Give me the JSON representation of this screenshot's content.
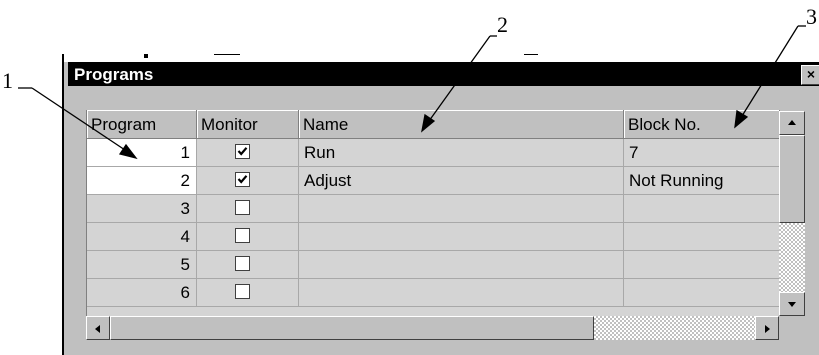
{
  "callouts": [
    "1",
    "2",
    "3"
  ],
  "window": {
    "title": "Programs",
    "close_glyph": "×"
  },
  "columns": [
    "Program",
    "Monitor",
    "Name",
    "Block No."
  ],
  "rows": [
    {
      "program": "1",
      "monitor": true,
      "name": "Run",
      "block": "7"
    },
    {
      "program": "2",
      "monitor": true,
      "name": "Adjust",
      "block": "Not Running"
    },
    {
      "program": "3",
      "monitor": false,
      "name": "",
      "block": ""
    },
    {
      "program": "4",
      "monitor": false,
      "name": "",
      "block": ""
    },
    {
      "program": "5",
      "monitor": false,
      "name": "",
      "block": ""
    },
    {
      "program": "6",
      "monitor": false,
      "name": "",
      "block": ""
    }
  ],
  "icons": {
    "up": "arrow-up-icon",
    "down": "arrow-down-icon",
    "left": "arrow-left-icon",
    "right": "arrow-right-icon",
    "check": "checkmark-icon"
  }
}
